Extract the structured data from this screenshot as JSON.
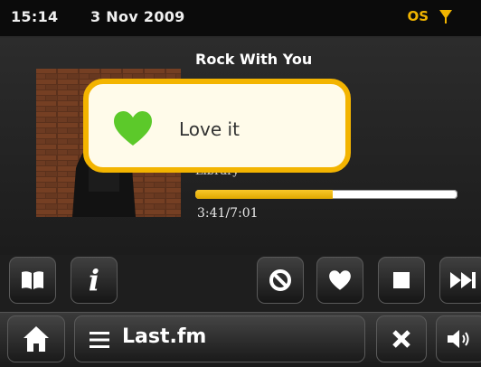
{
  "status": {
    "time": "15:14",
    "date": "3 Nov 2009",
    "os_indicator": "OS",
    "network_icon": "network-signal-icon",
    "accent": "#f0b400"
  },
  "now_playing": {
    "title": "Rock With You",
    "source": "Library",
    "elapsed_total": "3:41/7:01",
    "progress_fraction": 0.525
  },
  "popup": {
    "icon": "heart-icon",
    "text": "Love it",
    "heart_color": "#5cc92a",
    "border_color": "#f3b400"
  },
  "controls": {
    "left": [
      "book-icon",
      "info-icon"
    ],
    "right": [
      "ban-icon",
      "heart-icon",
      "stop-icon",
      "skip-next-icon"
    ]
  },
  "bottom_bar": {
    "home_icon": "home-icon",
    "menu_icon": "menu-icon",
    "source_label": "Last.fm",
    "close_icon": "close-icon",
    "volume_icon": "volume-icon"
  }
}
